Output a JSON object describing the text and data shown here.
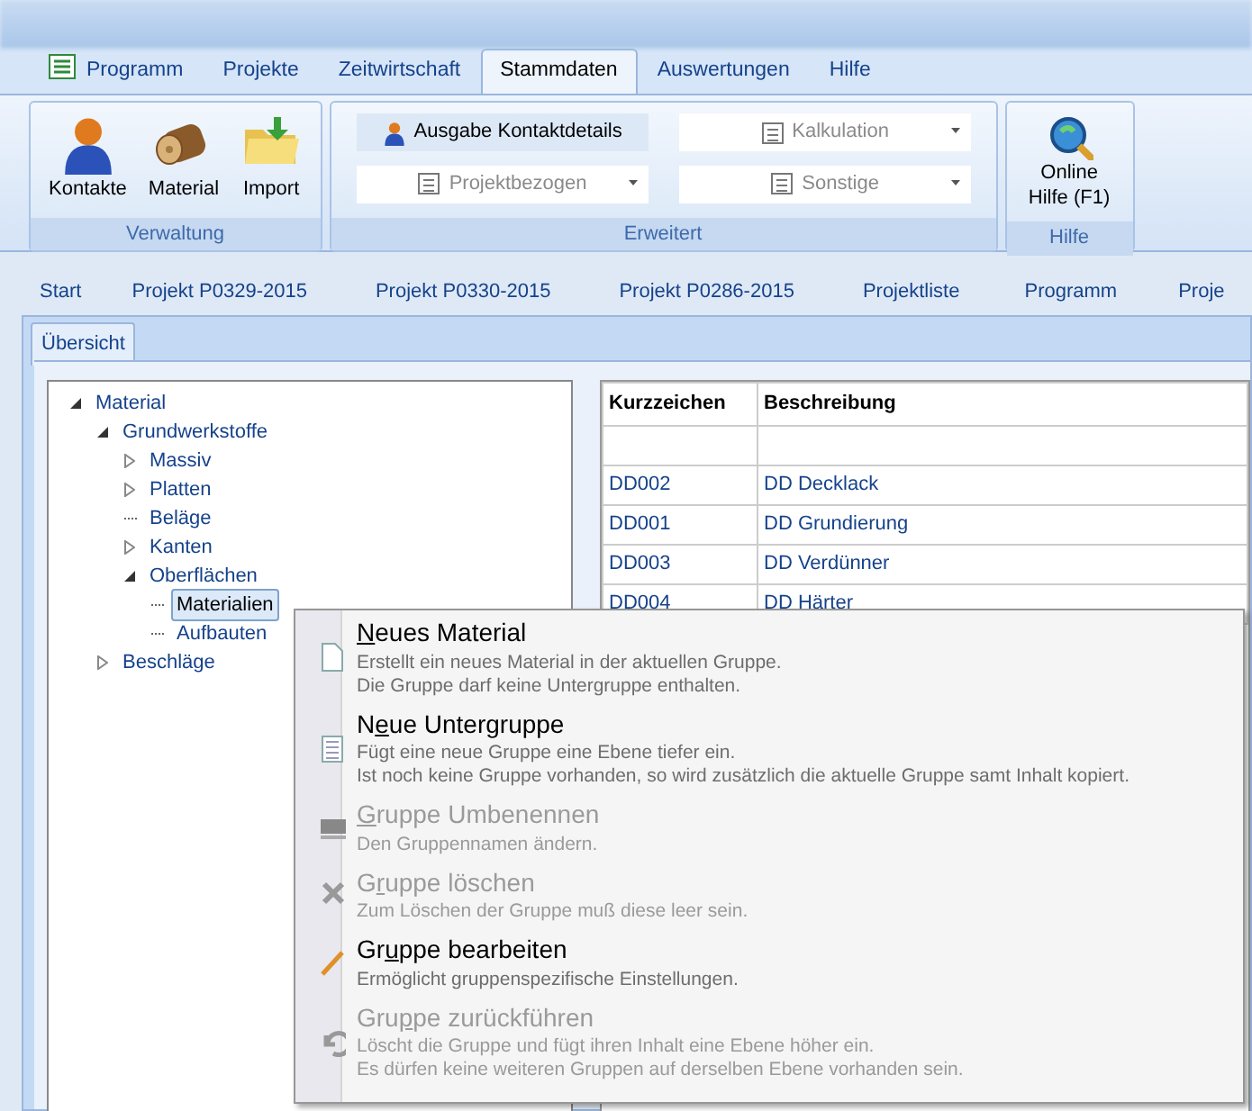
{
  "ribbon": {
    "tabs": [
      {
        "label": "Programm",
        "selected": false,
        "kind": "app"
      },
      {
        "label": "Projekte",
        "selected": false,
        "kind": "plain"
      },
      {
        "label": "Zeitwirtschaft",
        "selected": false,
        "kind": "plain"
      },
      {
        "label": "Stammdaten",
        "selected": true,
        "kind": "plain"
      },
      {
        "label": "Auswertungen",
        "selected": false,
        "kind": "plain"
      },
      {
        "label": "Hilfe",
        "selected": false,
        "kind": "plain"
      }
    ],
    "groups": [
      {
        "title": "Verwaltung",
        "kind": "large",
        "buttons": [
          {
            "label": "Kontakte"
          },
          {
            "label": "Material"
          },
          {
            "label": "Import"
          }
        ]
      },
      {
        "title": "Erweitert",
        "kind": "small",
        "buttons": [
          {
            "label": "Ausgabe Kontaktdetails",
            "kind": "button",
            "disabled": false
          },
          {
            "label": "Kalkulation",
            "kind": "dropdown",
            "disabled": true
          },
          {
            "label": "Projektbezogen",
            "kind": "dropdown",
            "disabled": true
          },
          {
            "label": "Sonstige",
            "kind": "dropdown",
            "disabled": true
          }
        ]
      },
      {
        "title": "Hilfe",
        "kind": "large",
        "buttons": [
          {
            "label": "Online Hilfe (F1)"
          }
        ]
      }
    ]
  },
  "document_tabs": [
    "Start",
    "Projekt P0329-2015",
    "Projekt P0330-2015",
    "Projekt P0286-2015",
    "Projektliste",
    "Programm",
    "Proje"
  ],
  "view_tab": {
    "label": "Übersicht",
    "selected": true
  },
  "tree": [
    {
      "label": "Material",
      "kind": "branch",
      "expanded": true,
      "selected": false,
      "children": [
        {
          "label": "Grundwerkstoffe",
          "kind": "branch",
          "expanded": true,
          "selected": false,
          "children": [
            {
              "label": "Massiv",
              "kind": "branch",
              "expanded": false,
              "selected": false
            },
            {
              "label": "Platten",
              "kind": "branch",
              "expanded": false,
              "selected": false
            },
            {
              "label": "Beläge",
              "kind": "leaf",
              "selected": false
            },
            {
              "label": "Kanten",
              "kind": "branch",
              "expanded": false,
              "selected": false
            },
            {
              "label": "Oberflächen",
              "kind": "branch",
              "expanded": true,
              "selected": false,
              "children": [
                {
                  "label": "Materialien",
                  "kind": "leaf",
                  "selected": true
                },
                {
                  "label": "Aufbauten",
                  "kind": "leaf",
                  "selected": false
                }
              ]
            }
          ]
        },
        {
          "label": "Beschläge",
          "kind": "branch",
          "expanded": false,
          "selected": false
        }
      ]
    }
  ],
  "table": {
    "columns": [
      "Kurzzeichen",
      "Beschreibung"
    ],
    "rows": [
      [
        "DD002",
        "DD Decklack"
      ],
      [
        "DD001",
        "DD Grundierung"
      ],
      [
        "DD003",
        "DD Verdünner"
      ],
      [
        "DD004",
        "DD Härter"
      ]
    ]
  },
  "context_menu": [
    {
      "access_key": "N",
      "label_post": "eues Material",
      "disabled": false,
      "description": [
        "Erstellt ein neues Material in der aktuellen Gruppe.",
        "Die Gruppe darf keine Untergruppe enthalten."
      ]
    },
    {
      "label_pre": "N",
      "access_key": "e",
      "label_post": "ue Untergruppe",
      "disabled": false,
      "description": [
        "Fügt eine neue Gruppe eine Ebene tiefer ein.",
        "Ist noch keine Gruppe vorhanden, so wird zusätzlich die aktuelle Gruppe samt Inhalt kopiert."
      ]
    },
    {
      "access_key": "G",
      "label_post": "ruppe Umbenennen",
      "disabled": true,
      "description": [
        "Den Gruppennamen ändern."
      ]
    },
    {
      "label_pre": "G",
      "access_key": "r",
      "label_post": "uppe löschen",
      "disabled": true,
      "description": [
        "Zum Löschen der Gruppe muß diese leer sein."
      ]
    },
    {
      "label_pre": "Gr",
      "access_key": "u",
      "label_post": "ppe bearbeiten",
      "disabled": false,
      "description": [
        "Ermöglicht gruppenspezifische Einstellungen."
      ]
    },
    {
      "label_pre": "Gru",
      "access_key": "p",
      "label_post": "pe zurückführen",
      "disabled": true,
      "description": [
        "Löscht die Gruppe und fügt ihren Inhalt eine Ebene höher ein.",
        "Es dürfen keine weiteren Gruppen auf derselben Ebene vorhanden sein."
      ]
    }
  ]
}
